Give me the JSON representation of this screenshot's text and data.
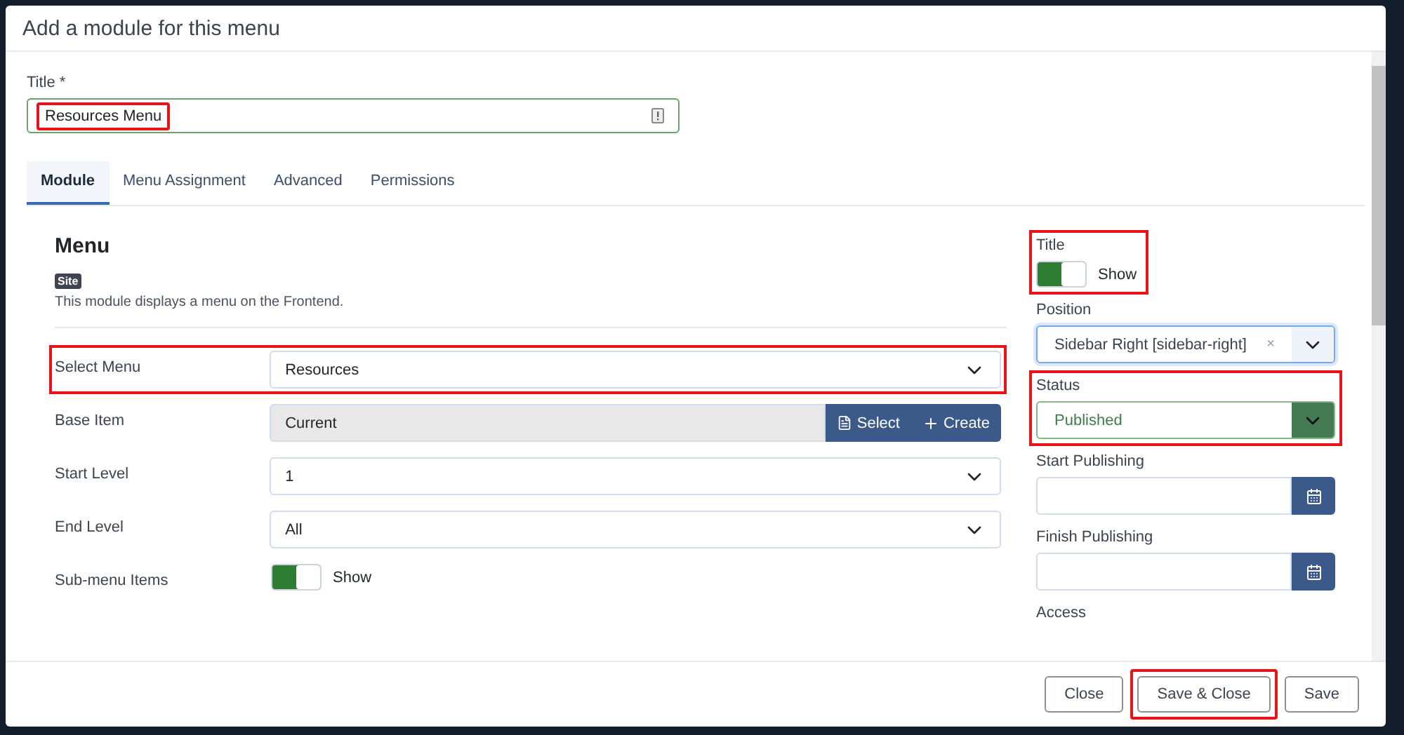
{
  "dialog": {
    "title": "Add a module for this menu"
  },
  "title_field": {
    "label": "Title *",
    "value": "Resources Menu",
    "highlighted": true
  },
  "tabs": [
    {
      "label": "Module",
      "selected": true
    },
    {
      "label": "Menu Assignment",
      "selected": false
    },
    {
      "label": "Advanced",
      "selected": false
    },
    {
      "label": "Permissions",
      "selected": false
    }
  ],
  "module": {
    "heading": "Menu",
    "badge": "Site",
    "description": "This module displays a menu on the Frontend."
  },
  "left_fields": [
    {
      "kind": "select",
      "label": "Select Menu",
      "value": "Resources",
      "highlighted": true
    },
    {
      "kind": "modal",
      "label": "Base Item",
      "value": "Current",
      "buttons": [
        "Select",
        "Create"
      ],
      "highlighted": false
    },
    {
      "kind": "select",
      "label": "Start Level",
      "value": "1",
      "highlighted": false
    },
    {
      "kind": "select",
      "label": "End Level",
      "value": "All",
      "highlighted": false
    },
    {
      "kind": "toggle",
      "label": "Sub-menu Items",
      "on": true,
      "state_label": "Show",
      "highlighted": false
    }
  ],
  "right_fields": [
    {
      "kind": "toggle",
      "label": "Title",
      "on": true,
      "state_label": "Show",
      "highlighted": true
    },
    {
      "kind": "select",
      "label": "Position",
      "value": "Sidebar Right [sidebar-right]",
      "clear": "×",
      "highlighted": false
    },
    {
      "kind": "status",
      "label": "Status",
      "value": "Published",
      "highlighted": true
    },
    {
      "kind": "date",
      "label": "Start Publishing",
      "highlighted": false
    },
    {
      "kind": "date",
      "label": "Finish Publishing",
      "highlighted": false
    },
    {
      "kind": "label",
      "label": "Access",
      "highlighted": false
    }
  ],
  "footer_buttons": [
    {
      "label": "Close",
      "highlighted": false
    },
    {
      "label": "Save & Close",
      "highlighted": true
    },
    {
      "label": "Save",
      "highlighted": false
    }
  ]
}
